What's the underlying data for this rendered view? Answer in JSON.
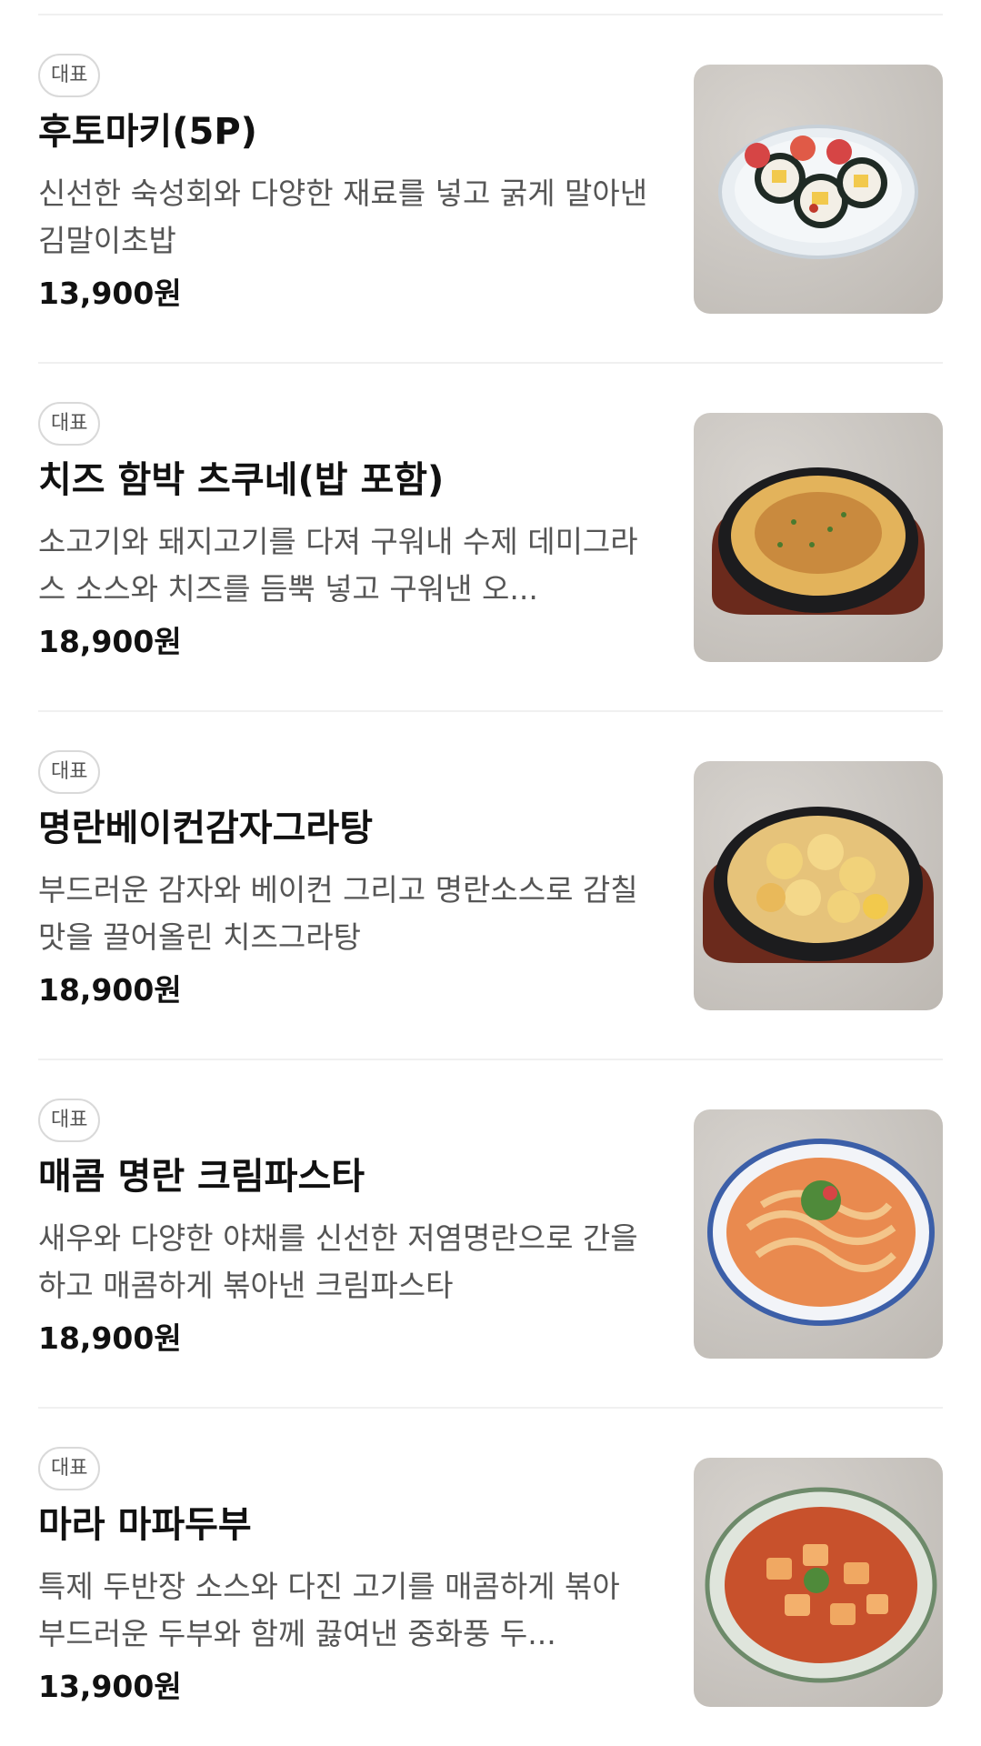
{
  "menu": {
    "items": [
      {
        "badge": "대표",
        "name": "후토마키(5P)",
        "desc": "신선한 숙성회와 다양한 재료를 넣고 굵게 말아낸 김말이초밥",
        "price": "13,900원",
        "image_icon": "futomaki-photo"
      },
      {
        "badge": "대표",
        "name": "치즈 함박 츠쿠네(밥 포함)",
        "desc": "소고기와 돼지고기를 다져 구워내 수제 데미그라스 소스와 치즈를 듬뿍 넣고 구워낸 오...",
        "price": "18,900원",
        "image_icon": "cheese-hamburg-photo"
      },
      {
        "badge": "대표",
        "name": "명란베이컨감자그라탕",
        "desc": "부드러운 감자와 베이컨 그리고 명란소스로 감칠맛을 끌어올린 치즈그라탕",
        "price": "18,900원",
        "image_icon": "potato-gratin-photo"
      },
      {
        "badge": "대표",
        "name": "매콤 명란 크림파스타",
        "desc": "새우와 다양한 야채를 신선한 저염명란으로 간을 하고 매콤하게 볶아낸 크림파스타",
        "price": "18,900원",
        "image_icon": "cream-pasta-photo"
      },
      {
        "badge": "대표",
        "name": "마라 마파두부",
        "desc": "특제 두반장 소스와 다진 고기를 매콤하게 볶아 부드러운 두부와 함께 끓여낸 중화풍 두...",
        "price": "13,900원",
        "image_icon": "mapo-tofu-photo"
      }
    ]
  }
}
